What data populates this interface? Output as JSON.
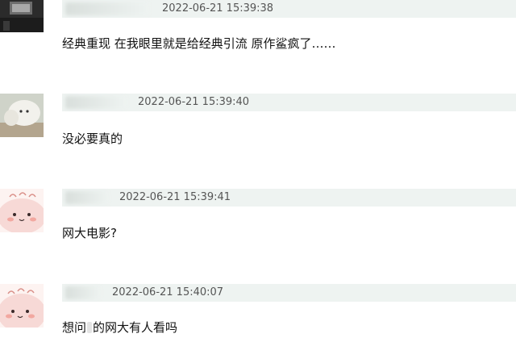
{
  "comments": [
    {
      "timestamp": "2022-06-21 15:39:38",
      "text": "经典重现 在我眼里就是给经典引流 原作鲨疯了……"
    },
    {
      "timestamp": "2022-06-21 15:39:40",
      "text": "没必要真的"
    },
    {
      "timestamp": "2022-06-21 15:39:41",
      "text": "网大电影?"
    },
    {
      "timestamp": "2022-06-21 15:40:07",
      "text_before": "想问",
      "text_after": "的网大有人看吗"
    }
  ],
  "colors": {
    "meta_bar": "#eef3f1",
    "timestamp_text": "#555555",
    "body_text": "#111111",
    "avatar_pink": "#f7d9d6"
  },
  "icons": {
    "avatar_1": "dark-room-photo-avatar",
    "avatar_2": "plush-toy-photo-avatar",
    "avatar_3": "pink-bun-cartoon-avatar",
    "avatar_4": "pink-bun-cartoon-avatar"
  }
}
